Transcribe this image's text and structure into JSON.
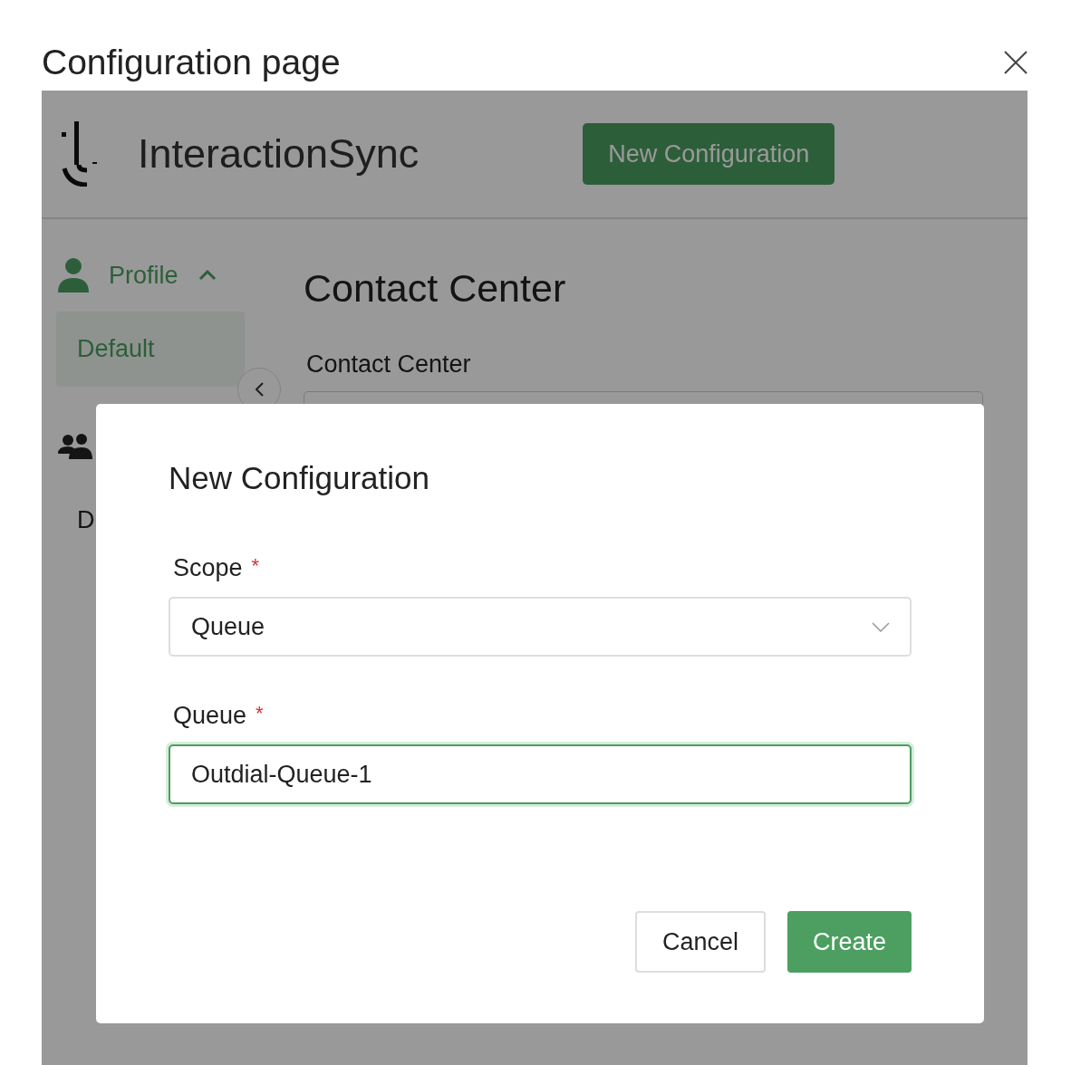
{
  "page_title": "Configuration page",
  "app": {
    "brand": "InteractionSync",
    "header_button": "New Configuration",
    "sidebar": {
      "groups": [
        {
          "kind": "person",
          "label": "Profile",
          "expanded": true,
          "items": [
            {
              "label": "Default",
              "selected": true
            }
          ]
        },
        {
          "kind": "people",
          "items": [
            {
              "label": "D",
              "selected": false
            }
          ]
        }
      ]
    },
    "main": {
      "heading": "Contact Center",
      "field_label": "Contact Center"
    }
  },
  "modal": {
    "title": "New Configuration",
    "fields": [
      {
        "kind": "select",
        "label": "Scope",
        "required_mark": "*",
        "value": "Queue",
        "focused": false
      },
      {
        "kind": "text",
        "label": "Queue",
        "required_mark": "*",
        "value": "Outdial-Queue-1",
        "focused": true
      }
    ],
    "buttons": [
      {
        "label": "Cancel",
        "kind": "secondary"
      },
      {
        "label": "Create",
        "kind": "primary"
      }
    ]
  }
}
